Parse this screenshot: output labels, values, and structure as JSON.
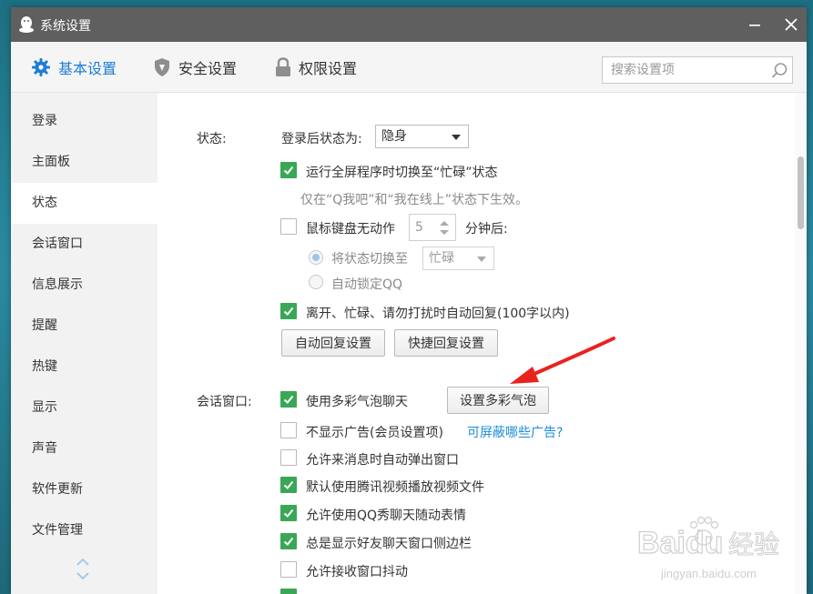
{
  "window": {
    "title": "系统设置"
  },
  "tabs": [
    {
      "label": "基本设置",
      "active": true
    },
    {
      "label": "安全设置"
    },
    {
      "label": "权限设置"
    }
  ],
  "search": {
    "placeholder": "搜索设置项"
  },
  "sidebar": {
    "items": [
      "登录",
      "主面板",
      "状态",
      "会话窗口",
      "信息展示",
      "提醒",
      "热键",
      "显示",
      "声音",
      "软件更新",
      "文件管理"
    ],
    "active_index": 2
  },
  "status_section": {
    "label": "状态:",
    "login_status_label": "登录后状态为:",
    "login_status_value": "隐身",
    "fullscreen_busy": {
      "label": "运行全屏程序时切换至“忙碌”状态",
      "checked": true
    },
    "fullscreen_hint": "仅在“Q我吧”和“我在线上”状态下生效。",
    "idle": {
      "label": "鼠标键盘无动作",
      "checked": false,
      "minutes": "5",
      "suffix": "分钟后:"
    },
    "switch_status": {
      "label": "将状态切换至",
      "value": "忙碌",
      "selected": true
    },
    "auto_lock": {
      "label": "自动锁定QQ",
      "selected": false
    },
    "auto_reply": {
      "label": "离开、忙碌、请勿打扰时自动回复(100字以内)",
      "checked": true
    },
    "auto_reply_btn": "自动回复设置",
    "quick_reply_btn": "快捷回复设置"
  },
  "chat_section": {
    "label": "会话窗口:",
    "bubble": {
      "label": "使用多彩气泡聊天",
      "checked": true
    },
    "bubble_btn": "设置多彩气泡",
    "no_ads": {
      "label": "不显示广告(会员设置项)",
      "checked": false
    },
    "ads_link": "可屏蔽哪些广告?",
    "auto_popup": {
      "label": "允许来消息时自动弹出窗口",
      "checked": false
    },
    "tencent_video": {
      "label": "默认使用腾讯视频播放视频文件",
      "checked": true
    },
    "qq_show": {
      "label": "允许使用QQ秀聊天随动表情",
      "checked": true
    },
    "sidebar_show": {
      "label": "总是显示好友聊天窗口侧边栏",
      "checked": true
    },
    "shake": {
      "label": "允许接收窗口抖动",
      "checked": false
    }
  },
  "watermark": {
    "brand": "Baidu",
    "cn": "经验",
    "url": "jingyan.baidu.com"
  },
  "colors": {
    "accent": "#1d7dd6",
    "check_green": "#3aa757",
    "titlebar": "#5f5f5f",
    "arrow_red": "#e8231e",
    "link": "#1a8ed9"
  }
}
